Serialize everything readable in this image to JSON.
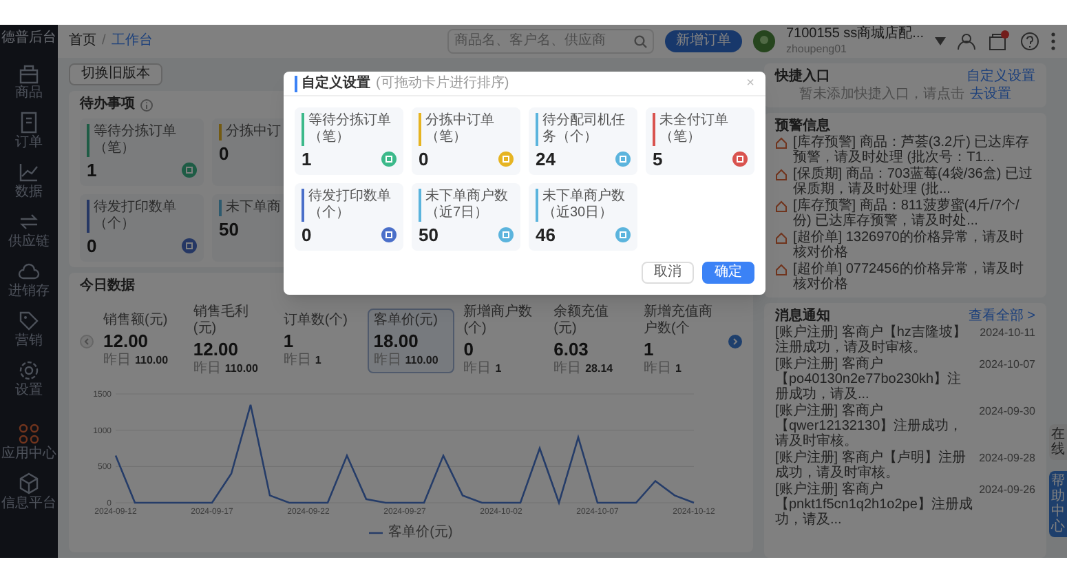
{
  "sidebar": {
    "logo": "德普后台",
    "items": [
      {
        "label": "商品"
      },
      {
        "label": "订单"
      },
      {
        "label": "数据"
      },
      {
        "label": "供应链"
      },
      {
        "label": "进销存"
      },
      {
        "label": "营销"
      },
      {
        "label": "设置"
      },
      {
        "label": "应用中心"
      },
      {
        "label": "信息平台"
      }
    ]
  },
  "header": {
    "breadcrumb": [
      "首页",
      "工作台"
    ],
    "separator": "/",
    "search": {
      "placeholder": "商品名、客户名、供应商"
    },
    "action_button": "新增订单",
    "user": {
      "name": "7100155 ss商城店配...",
      "account": "zhoupeng01"
    }
  },
  "switch_button": "切换旧版本",
  "todo": {
    "title": "待办事项",
    "cards": [
      {
        "label": "等待分拣订单（笔）",
        "value": "1",
        "color": "#1e5c45"
      },
      {
        "label": "分拣中订",
        "value": "0",
        "color": "#735a11"
      },
      {
        "label": "待发打印数单（个）",
        "value": "0",
        "color": "#253764"
      },
      {
        "label": "未下单商",
        "value": "50",
        "color": "#2d5a6e"
      }
    ]
  },
  "today": {
    "title": "今日数据",
    "metrics": [
      {
        "label": "销售额(元)",
        "value": "12.00",
        "prev_label": "昨日",
        "prev": "110.00",
        "selected": false
      },
      {
        "label": "销售毛利(元)",
        "value": "12.00",
        "prev_label": "昨日",
        "prev": "110.00",
        "selected": false
      },
      {
        "label": "订单数(个)",
        "value": "1",
        "prev_label": "昨日",
        "prev": "1",
        "selected": false
      },
      {
        "label": "客单价(元)",
        "value": "18.00",
        "prev_label": "昨日",
        "prev": "110.00",
        "selected": true
      },
      {
        "label": "新增商户数(个)",
        "value": "0",
        "prev_label": "昨日",
        "prev": "1",
        "selected": false
      },
      {
        "label": "余额充值(元)",
        "value": "6.03",
        "prev_label": "昨日",
        "prev": "28.14",
        "selected": false
      },
      {
        "label": "新增充值商户数(个",
        "value": "1",
        "prev_label": "昨日",
        "prev": "1",
        "selected": false
      }
    ],
    "chart_data": {
      "type": "line",
      "categories": [
        "2024-09-12",
        null,
        null,
        null,
        null,
        "2024-09-17",
        null,
        null,
        null,
        null,
        "2024-09-22",
        null,
        null,
        null,
        null,
        "2024-09-27",
        null,
        null,
        null,
        null,
        "2024-10-02",
        null,
        null,
        null,
        null,
        "2024-10-07",
        null,
        null,
        null,
        null,
        "2024-10-12"
      ],
      "series": [
        {
          "name": "客单价(元)",
          "color": "#253c68",
          "values": [
            650,
            0,
            0,
            0,
            0,
            0,
            400,
            1350,
            100,
            0,
            0,
            0,
            650,
            50,
            0,
            0,
            0,
            650,
            100,
            0,
            0,
            0,
            750,
            0,
            900,
            0,
            0,
            0,
            300,
            100,
            0
          ]
        }
      ],
      "ylim": [
        0,
        1500
      ],
      "yticks": [
        0,
        500,
        1000,
        1500
      ]
    }
  },
  "quick": {
    "title": "快捷入口",
    "link": "自定义设置",
    "empty_text": "暂未添加快捷入口，请点击",
    "empty_link": "去设置"
  },
  "alerts": {
    "title": "预警信息",
    "items": [
      "[库存预警] 商品：芦荟(3.2斤) 已达库存预警，请及时处理 (批次号：T1...",
      "[保质期] 商品：703蓝莓(4袋/36盒) 已过保质期，请及时处理 (批...",
      "[库存预警] 商品：811菠萝蜜(4斤/7个/份) 已达库存预警，请及时处...",
      "[超价单] 1326970的价格异常，请及时核对价格",
      "[超价单] 0772456的价格异常，请及时核对价格"
    ]
  },
  "messages": {
    "title": "消息通知",
    "link": "查看全部 >",
    "items": [
      {
        "text": "[账户注册] 客商户【hz吉隆坡】注册成功，请及时审核。",
        "date": "2024-10-11"
      },
      {
        "text": "[账户注册] 客商户【po40130n2e77bo230kh】注册成功，请及...",
        "date": "2024-10-07"
      },
      {
        "text": "[账户注册] 客商户【qwer12132130】注册成功，请及时审核。",
        "date": "2024-09-30"
      },
      {
        "text": "[账户注册] 客商户【卢明】注册成功，请及时审核。",
        "date": "2024-09-28"
      },
      {
        "text": "[账户注册] 客商户【pnkt1f5cn1q2h1o2pe】注册成功，请及...",
        "date": "2024-09-26"
      }
    ]
  },
  "side_tabs": [
    "在线",
    "帮助中心"
  ],
  "modal": {
    "title": "自定义设置",
    "subtitle": "(可拖动卡片进行排序)",
    "close": "×",
    "cards": [
      {
        "label": "等待分拣订单（笔）",
        "value": "1",
        "color": "#3cb98a"
      },
      {
        "label": "分拣中订单（笔）",
        "value": "0",
        "color": "#e6b422"
      },
      {
        "label": "待分配司机任务（个）",
        "value": "24",
        "color": "#5bb4dd"
      },
      {
        "label": "未全付订单（笔）",
        "value": "5",
        "color": "#d9534f"
      },
      {
        "label": "待发打印数单（个）",
        "value": "0",
        "color": "#4a6fc9"
      },
      {
        "label": "未下单商户数（近7日）",
        "value": "50",
        "color": "#5bb4dd"
      },
      {
        "label": "未下单商户数（近30日）",
        "value": "46",
        "color": "#5bb4dd"
      }
    ],
    "buttons": [
      {
        "label": "取消",
        "kind": "secondary"
      },
      {
        "label": "确定",
        "kind": "primary"
      }
    ]
  }
}
